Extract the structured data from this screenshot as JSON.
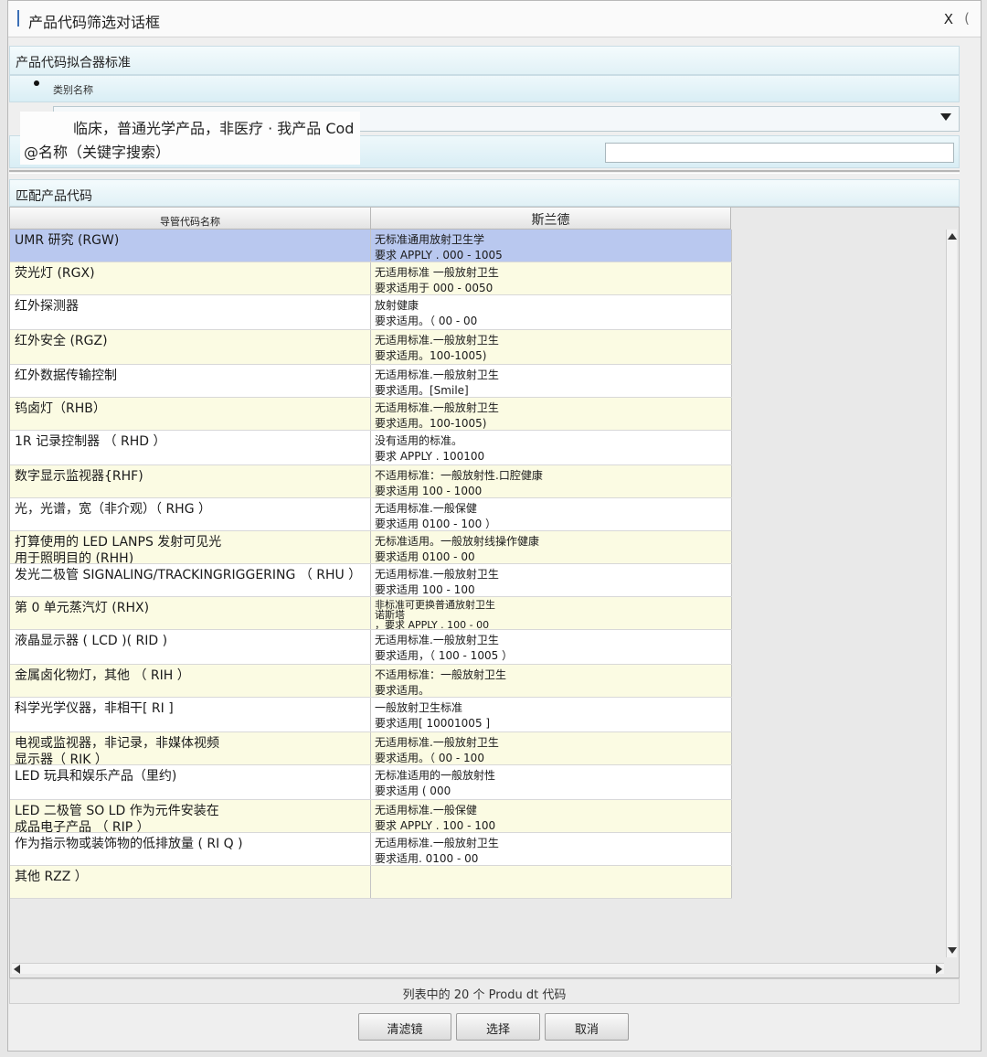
{
  "window": {
    "title": "产品代码筛选对话框",
    "close_label": "X",
    "extra_label": "("
  },
  "criteria": {
    "header": "产品代码拟合器标准",
    "category_label": "类别名称",
    "category_value": "临床，普通光学产品，非医疗 · 我产品 Cod",
    "name_label": "@名称（关键字搜索）",
    "name_value": ""
  },
  "results": {
    "header": "匹配产品代码",
    "columns": [
      "导管代码名称",
      "斯兰德"
    ],
    "rows": [
      {
        "name": [
          "UMR 研究 (RGW)"
        ],
        "desc": [
          "无标准通用放射卫生学",
          "要求 APPLY . 000 - 1005"
        ],
        "style": "sel"
      },
      {
        "name": [
          "荧光灯 (RGX)"
        ],
        "desc": [
          "无适用标准 一般放射卫生",
          "要求适用于 000 - 0050"
        ],
        "style": "y"
      },
      {
        "name": [
          "红外探测器"
        ],
        "desc": [
          "放射健康",
          "要求适用。（ 00 - 00"
        ],
        "style": "w"
      },
      {
        "name": [
          "红外安全 (RGZ)"
        ],
        "desc": [
          "无适用标准.一般放射卫生",
          "要求适用。100-1005)"
        ],
        "style": "y"
      },
      {
        "name": [
          "红外数据传输控制"
        ],
        "desc": [
          "无适用标准.一般放射卫生",
          "要求适用。[Smile]"
        ],
        "style": "w"
      },
      {
        "name": [
          "钨卤灯（RHB）"
        ],
        "desc": [
          "无适用标准.一般放射卫生",
          "要求适用。100-1005)"
        ],
        "style": "y"
      },
      {
        "name": [
          "1R 记录控制器 （ RHD ）"
        ],
        "desc": [
          "没有适用的标准。",
          "要求 APPLY . 100100"
        ],
        "style": "w"
      },
      {
        "name": [
          "数字显示监视器{RHF)"
        ],
        "desc": [
          "不适用标准：一般放射性.口腔健康",
          "要求适用 100 - 1000"
        ],
        "style": "y"
      },
      {
        "name": [
          "光，光谱，宽（非介观）（ RHG ）"
        ],
        "desc": [
          "无适用标准.一般保健",
          "要求适用 0100 - 100 ）"
        ],
        "style": "w"
      },
      {
        "name": [
          "打算使用的 LED LANPS 发射可见光",
          "用于照明目的 (RHH)"
        ],
        "desc": [
          "无标准适用。一般放射线操作健康",
          "要求适用 0100 - 00"
        ],
        "style": "y"
      },
      {
        "name": [
          "发光二极管 SIGNALING/TRACKINGRIGGERING （ RHU ）"
        ],
        "desc": [
          "无适用标准.一般放射卫生",
          "要求适用 100 - 100"
        ],
        "style": "w"
      },
      {
        "name": [
          "第 0 单元蒸汽灯 (RHX)"
        ],
        "desc": [
          "非标准可更换普通放射卫生",
          "诺斯塔",
          "，要求 APPLY . 100 - 00"
        ],
        "style": "y"
      },
      {
        "name": [
          "液晶显示器 ( LCD )( RID )"
        ],
        "desc": [
          "无适用标准.一般放射卫生",
          "要求适用，（ 100 - 1005 ）"
        ],
        "style": "w"
      },
      {
        "name": [
          "金属卤化物灯，其他 （ RIH ）"
        ],
        "desc": [
          "不适用标准：一般放射卫生",
          "要求适用。"
        ],
        "style": "y"
      },
      {
        "name": [
          "科学光学仪器，非相干[ RI ]"
        ],
        "desc": [
          "一般放射卫生标准",
          "要求适用[ 10001005 ]"
        ],
        "style": "w"
      },
      {
        "name": [
          "电视或监视器，非记录，非媒体视频",
          "显示器（ RIK ）_"
        ],
        "desc": [
          "无适用标准.一般放射卫生",
          "要求适用。（ 00 - 100"
        ],
        "style": "y"
      },
      {
        "name": [
          "LED 玩具和娱乐产品（里约)"
        ],
        "desc": [
          "无标准适用的一般放射性",
          "要求适用 ( 000"
        ],
        "style": "w"
      },
      {
        "name": [
          "LED 二极管 SO LD 作为元件安装在",
          "成品电子产品 （ RIP ）"
        ],
        "desc": [
          "无适用标准.一般保健",
          "要求 APPLY . 100 - 100"
        ],
        "style": "y"
      },
      {
        "name": [
          "作为指示物或装饰物的低排放量 ( RI Q )"
        ],
        "desc": [
          "无适用标准.一般放射卫生",
          "要求适用. 0100 - 00"
        ],
        "style": "w"
      },
      {
        "name": [
          "其他 RZZ ）"
        ],
        "desc": [
          ""
        ],
        "style": "y"
      }
    ],
    "status": "列表中的 20 个 Produ dt 代码"
  },
  "buttons": {
    "clear": "清滤镜",
    "select": "选择",
    "cancel": "取消"
  }
}
